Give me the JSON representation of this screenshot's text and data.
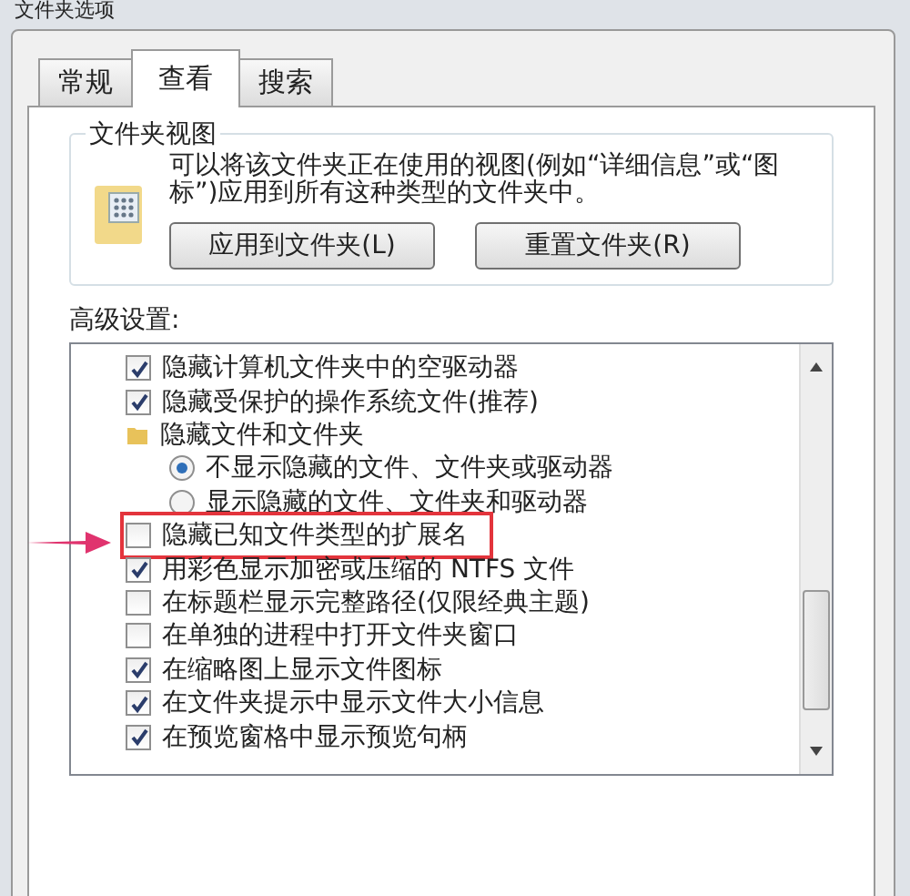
{
  "window": {
    "title": "文件夹选项"
  },
  "tabs": [
    {
      "label": "常规",
      "selected": false
    },
    {
      "label": "查看",
      "selected": true
    },
    {
      "label": "搜索",
      "selected": false
    }
  ],
  "folder_views": {
    "title": "文件夹视图",
    "description": "可以将该文件夹正在使用的视图(例如“详细信息”或“图标”)应用到所有这种类型的文件夹中。",
    "buttons": [
      "应用到文件夹(L)",
      "重置文件夹(R)"
    ]
  },
  "advanced": {
    "label": "高级设置:",
    "items": [
      {
        "kind": "checkbox",
        "label": "隐藏计算机文件夹中的空驱动器",
        "checked": true,
        "highlighted": false
      },
      {
        "kind": "checkbox",
        "label": "隐藏受保护的操作系统文件(推荐)",
        "checked": true,
        "highlighted": false
      },
      {
        "kind": "folder",
        "label": "隐藏文件和文件夹",
        "highlighted": false,
        "children": [
          {
            "kind": "radio",
            "label": "不显示隐藏的文件、文件夹或驱动器",
            "selected": true,
            "highlighted": false
          },
          {
            "kind": "radio",
            "label": "显示隐藏的文件、文件夹和驱动器",
            "selected": false,
            "highlighted": false
          }
        ]
      },
      {
        "kind": "checkbox",
        "label": "隐藏已知文件类型的扩展名",
        "checked": false,
        "highlighted": true
      },
      {
        "kind": "checkbox",
        "label": "用彩色显示加密或压缩的 NTFS 文件",
        "checked": true,
        "highlighted": false
      },
      {
        "kind": "checkbox",
        "label": "在标题栏显示完整路径(仅限经典主题)",
        "checked": false,
        "highlighted": false
      },
      {
        "kind": "checkbox",
        "label": "在单独的进程中打开文件夹窗口",
        "checked": false,
        "highlighted": false
      },
      {
        "kind": "checkbox",
        "label": "在缩略图上显示文件图标",
        "checked": true,
        "highlighted": false
      },
      {
        "kind": "checkbox",
        "label": "在文件夹提示中显示文件大小信息",
        "checked": true,
        "highlighted": false
      },
      {
        "kind": "checkbox",
        "label": "在预览窗格中显示预览句柄",
        "checked": true,
        "highlighted": false
      }
    ]
  }
}
